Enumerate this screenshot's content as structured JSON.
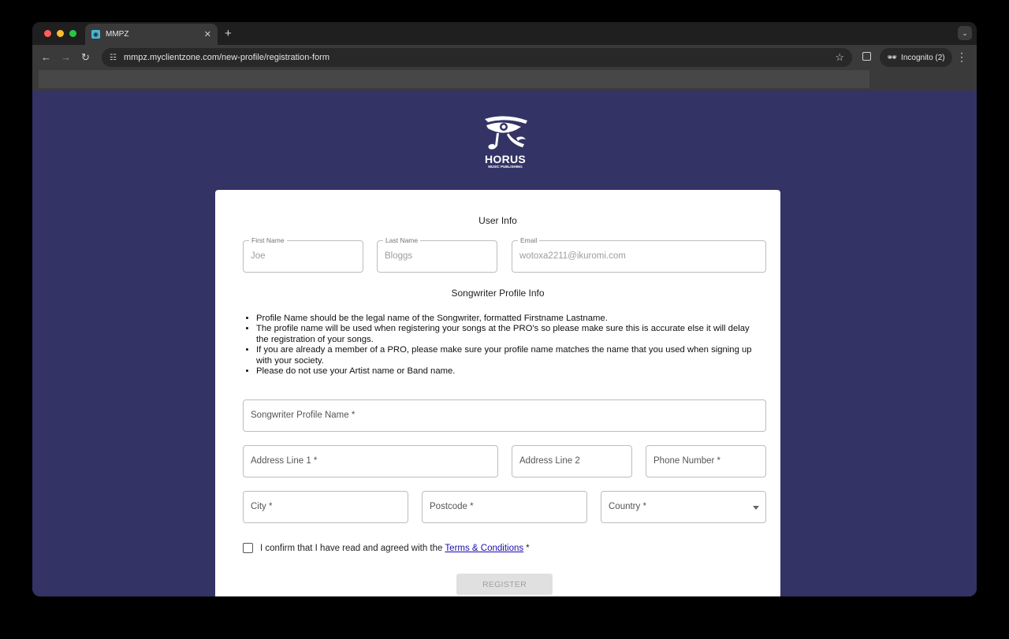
{
  "browser": {
    "tab_title": "MMPZ",
    "url": "mmpz.myclientzone.com/new-profile/registration-form",
    "incognito_label": "Incognito (2)"
  },
  "logo": {
    "brand": "HORUS",
    "subtitle": "MUSIC PUBLISHING"
  },
  "form": {
    "user_info_title": "User Info",
    "first_name": {
      "label": "First Name",
      "value": "Joe"
    },
    "last_name": {
      "label": "Last Name",
      "value": "Bloggs"
    },
    "email": {
      "label": "Email",
      "value": "wotoxa2211@ikuromi.com"
    },
    "songwriter_title": "Songwriter Profile Info",
    "info_items": [
      "Profile Name should be the legal name of the Songwriter, formatted Firstname Lastname.",
      "The profile name will be used when registering your songs at the PRO's so please make sure this is accurate else it will delay the registration of your songs.",
      "If you are already a member of a PRO, please make sure your profile name matches the name that you used when signing up with your society.",
      "Please do not use your Artist name or Band name."
    ],
    "profile_name_placeholder": "Songwriter Profile Name *",
    "address1_placeholder": "Address Line 1 *",
    "address2_placeholder": "Address Line 2",
    "phone_placeholder": "Phone Number *",
    "city_placeholder": "City *",
    "postcode_placeholder": "Postcode *",
    "country_placeholder": "Country *",
    "confirm_text": "I confirm that I have read and agreed with the",
    "terms_link": "Terms & Conditions",
    "required_mark": "*",
    "register_label": "REGISTER"
  }
}
